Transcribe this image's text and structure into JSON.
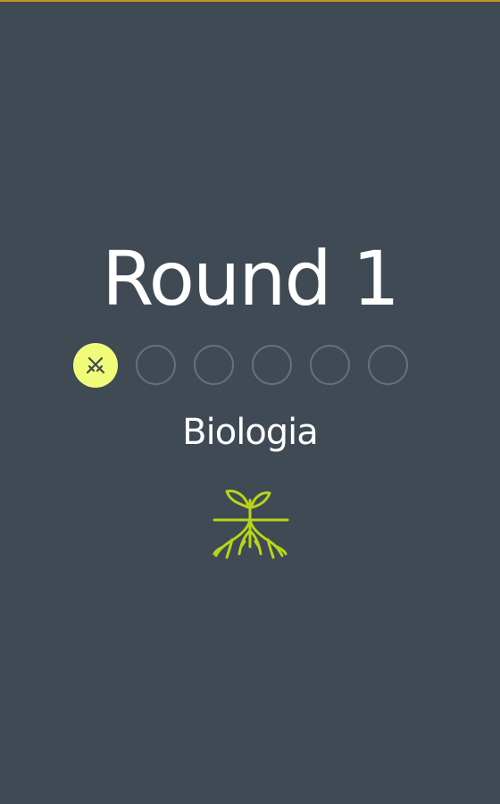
{
  "round": {
    "title": "Round 1"
  },
  "progress": {
    "total_steps": 6,
    "current_step": 1,
    "current_step_icon": "crossed-swords-icon"
  },
  "category": {
    "name": "Biologia",
    "icon": "plant-roots-icon",
    "color": "#b8d617"
  },
  "colors": {
    "background": "#3f4a54",
    "accent_strip": "#c9941e",
    "active_step": "#f1fb7a",
    "inactive_step_border": "#64717c"
  }
}
